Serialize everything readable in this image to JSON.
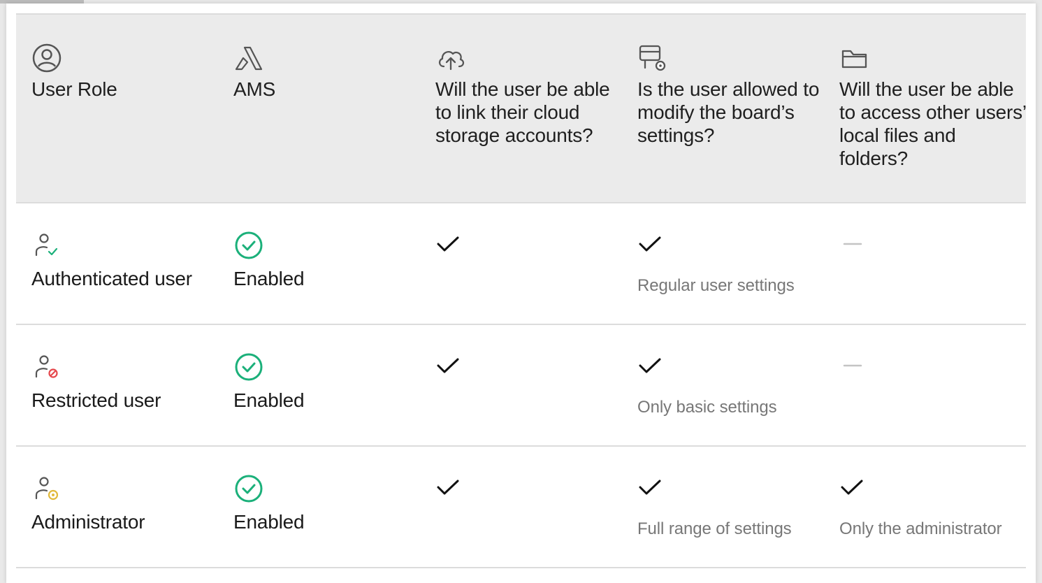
{
  "colors": {
    "header_bg": "#ebebeb",
    "enabled_green": "#1bb07a",
    "restricted_red": "#e5484d",
    "admin_yellow": "#e2b93b",
    "muted_text": "#777777"
  },
  "header": {
    "columns": [
      {
        "icon": "user-circle-icon",
        "label": "User Role"
      },
      {
        "icon": "ams-logo-icon",
        "label": "AMS"
      },
      {
        "icon": "cloud-upload-icon",
        "label": "Will the user be able to link their cloud storage accounts?"
      },
      {
        "icon": "board-settings-icon",
        "label": "Is the user allowed to modify the board’s settings?"
      },
      {
        "icon": "folder-icon",
        "label": "Will the user be able to access other users’ local files and folders?"
      }
    ]
  },
  "rows": [
    {
      "role_icon": "user-check-icon",
      "role": "Authenticated user",
      "ams_icon": "check-circle-icon",
      "ams": "Enabled",
      "cloud": "check-icon",
      "settings": "check-icon",
      "settings_note": "Regular user settings",
      "files": "dash-icon",
      "files_note": ""
    },
    {
      "role_icon": "user-blocked-icon",
      "role": "Restricted user",
      "ams_icon": "check-circle-icon",
      "ams": "Enabled",
      "cloud": "check-icon",
      "settings": "check-icon",
      "settings_note": "Only basic settings",
      "files": "dash-icon",
      "files_note": ""
    },
    {
      "role_icon": "user-admin-icon",
      "role": "Administrator",
      "ams_icon": "check-circle-icon",
      "ams": "Enabled",
      "cloud": "check-icon",
      "settings": "check-icon",
      "settings_note": "Full range of settings",
      "files": "check-icon",
      "files_note": "Only the administrator"
    }
  ]
}
